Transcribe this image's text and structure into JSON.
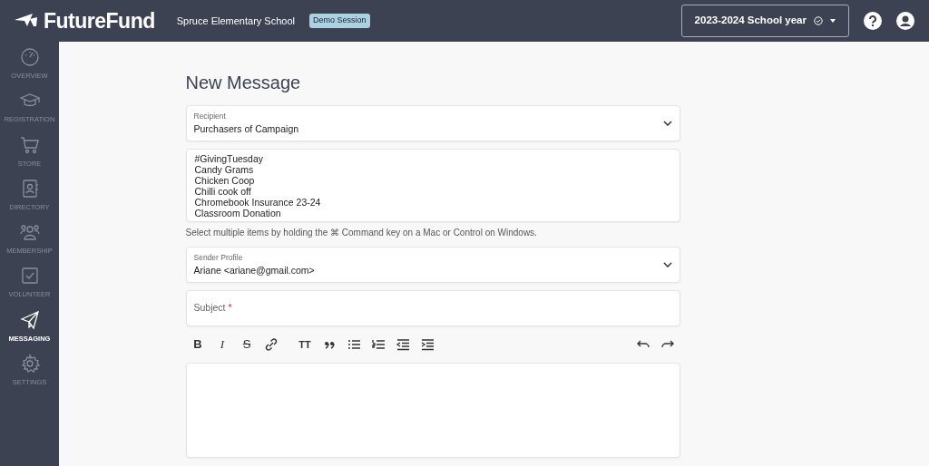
{
  "header": {
    "brand": "FutureFund",
    "school": "Spruce Elementary School",
    "session_badge": "Demo Session",
    "school_year": "2023-2024 School year"
  },
  "sidebar": {
    "items": [
      {
        "kind": "overview",
        "label": "OVERVIEW",
        "selected": false
      },
      {
        "kind": "registration",
        "label": "REGISTRATION",
        "selected": false
      },
      {
        "kind": "store",
        "label": "STORE",
        "selected": false
      },
      {
        "kind": "directory",
        "label": "DIRECTORY",
        "selected": false
      },
      {
        "kind": "membership",
        "label": "MEMBERSHIP",
        "selected": false
      },
      {
        "kind": "volunteer",
        "label": "VOLUNTEER",
        "selected": false
      },
      {
        "kind": "messaging",
        "label": "MESSAGING",
        "selected": true
      },
      {
        "kind": "settings",
        "label": "SETTINGS",
        "selected": false
      }
    ]
  },
  "page_title": "New Message",
  "recipient": {
    "label": "Recipient",
    "value": "Purchasers of Campaign"
  },
  "campaigns": {
    "options": [
      "#GivingTuesday",
      "Candy Grams",
      "Chicken Coop",
      "Chilli cook off",
      "Chromebook Insurance 23-24",
      "Classroom Donation"
    ],
    "help": "Select multiple items by holding the ⌘ Command key on a Mac or Control on Windows."
  },
  "sender": {
    "label": "Sender Profile",
    "value": "Ariane <ariane@gmail.com>"
  },
  "subject": {
    "placeholder": "Subject",
    "required_mark": "*"
  },
  "toolbar": [
    {
      "kind": "bold",
      "label": "B"
    },
    {
      "kind": "italic",
      "label": "I"
    },
    {
      "kind": "strike",
      "label": "S"
    },
    {
      "kind": "link"
    },
    {
      "kind": "heading",
      "label": "TT"
    },
    {
      "kind": "quote"
    },
    {
      "kind": "bullets"
    },
    {
      "kind": "numbers"
    },
    {
      "kind": "outdent"
    },
    {
      "kind": "indent"
    },
    {
      "kind": "undo"
    },
    {
      "kind": "redo"
    }
  ]
}
